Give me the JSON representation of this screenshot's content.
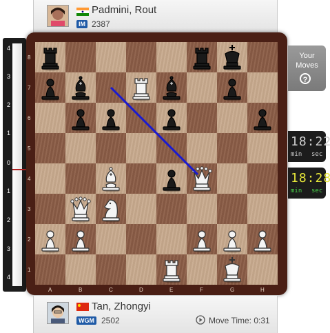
{
  "top_player": {
    "name": "Padmini, Rout",
    "title": "IM",
    "rating": "2387",
    "country": "India"
  },
  "bottom_player": {
    "name": "Tan, Zhongyi",
    "title": "WGM",
    "rating": "2502",
    "country": "China",
    "move_time_label": "Move Time: 0:31"
  },
  "eval_bar": {
    "labels": [
      "4",
      "3",
      "2",
      "1",
      "0",
      "1",
      "2",
      "3",
      "4"
    ],
    "level": 0
  },
  "your_moves": {
    "line1": "Your",
    "line2": "Moves",
    "help": "?"
  },
  "clocks": {
    "top": {
      "time": "18:22",
      "min_label": "min",
      "sec_label": "sec"
    },
    "bottom": {
      "time": "18:28",
      "min_label": "min",
      "sec_label": "sec"
    }
  },
  "board": {
    "files": [
      "A",
      "B",
      "C",
      "D",
      "E",
      "F",
      "G",
      "H"
    ],
    "ranks": [
      "8",
      "7",
      "6",
      "5",
      "4",
      "3",
      "2",
      "1"
    ],
    "pieces": [
      {
        "sq": "a8",
        "piece": "bR"
      },
      {
        "sq": "f8",
        "piece": "bR"
      },
      {
        "sq": "g8",
        "piece": "bK"
      },
      {
        "sq": "a7",
        "piece": "bP"
      },
      {
        "sq": "b7",
        "piece": "bB"
      },
      {
        "sq": "d7",
        "piece": "wR"
      },
      {
        "sq": "e7",
        "piece": "bB"
      },
      {
        "sq": "g7",
        "piece": "bP"
      },
      {
        "sq": "b6",
        "piece": "bP"
      },
      {
        "sq": "c6",
        "piece": "bP"
      },
      {
        "sq": "e6",
        "piece": "bP"
      },
      {
        "sq": "h6",
        "piece": "bP"
      },
      {
        "sq": "c4",
        "piece": "wB"
      },
      {
        "sq": "e4",
        "piece": "bP"
      },
      {
        "sq": "f4",
        "piece": "wQ"
      },
      {
        "sq": "b3",
        "piece": "wQ"
      },
      {
        "sq": "c3",
        "piece": "wN"
      },
      {
        "sq": "a2",
        "piece": "wP"
      },
      {
        "sq": "b2",
        "piece": "wP"
      },
      {
        "sq": "f2",
        "piece": "wP"
      },
      {
        "sq": "g2",
        "piece": "wP"
      },
      {
        "sq": "h2",
        "piece": "wP"
      },
      {
        "sq": "e1",
        "piece": "wR"
      },
      {
        "sq": "g1",
        "piece": "wK"
      }
    ],
    "arrow": {
      "from": "c7",
      "to": "f4",
      "color": "#1a1ad0"
    }
  },
  "colors": {
    "light_square": "#c8aa8e",
    "dark_square": "#8c5e47",
    "frame": "#4a1f15",
    "clock_top_digits": "#cfcfcf",
    "clock_bottom_digits": "#e8e83a",
    "clock_bottom_units": "#49d649",
    "title_badge": "#1f5aa6"
  }
}
